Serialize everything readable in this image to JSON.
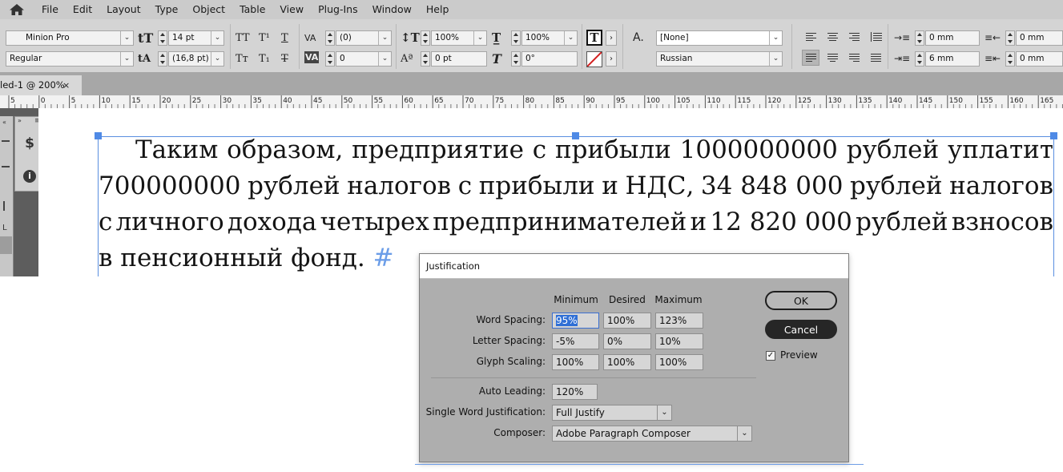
{
  "menu": [
    "File",
    "Edit",
    "Layout",
    "Type",
    "Object",
    "Table",
    "View",
    "Plug-Ins",
    "Window",
    "Help"
  ],
  "control": {
    "font_family": "Minion Pro",
    "font_style": "Regular",
    "font_size": "14 pt",
    "leading": "(16,8 pt)",
    "kerning": "(0)",
    "tracking": "0",
    "vertical_scale": "100%",
    "horizontal_scale": "100%",
    "baseline_shift": "0 pt",
    "skew": "0°",
    "char_style": "[None]",
    "language": "Russian",
    "left_indent": "0 mm",
    "right_indent": "0 mm",
    "first_line_indent": "6 mm",
    "last_line_indent": "0 mm"
  },
  "tab": {
    "label": "led-1 @ 200%",
    "close": "×"
  },
  "ruler": {
    "labels": [
      "5",
      "0",
      "5",
      "10",
      "15",
      "20",
      "25",
      "30",
      "35",
      "40",
      "45",
      "50",
      "55",
      "60",
      "65",
      "70",
      "75",
      "80",
      "85",
      "90",
      "95",
      "100",
      "105",
      "110",
      "115",
      "120",
      "125",
      "130",
      "135",
      "140",
      "145",
      "150",
      "155",
      "160",
      "165"
    ]
  },
  "text": {
    "line1": [
      "Таким",
      "образом,",
      "предприятие",
      "с",
      "прибыли",
      "1000000000",
      "рублей",
      "уплатит"
    ],
    "line2": [
      "700000000",
      "рублей",
      "налогов",
      "с",
      "прибыли",
      "и",
      "НДС,",
      "34 848 000",
      "рублей",
      "налогов"
    ],
    "line3": [
      "с",
      "личного",
      "дохода",
      "четырех",
      "предпринимателей",
      "и",
      "12 820 000",
      "рублей",
      "взносов"
    ],
    "line4": "в пенсионный фонд.",
    "end_mark": "#"
  },
  "dialog": {
    "title": "Justification",
    "headers": {
      "min": "Minimum",
      "desired": "Desired",
      "max": "Maximum"
    },
    "word_spacing": {
      "label": "Word Spacing:",
      "min": "95%",
      "desired": "100%",
      "max": "123%"
    },
    "letter_spacing": {
      "label": "Letter Spacing:",
      "min": "-5%",
      "desired": "0%",
      "max": "10%"
    },
    "glyph_scaling": {
      "label": "Glyph Scaling:",
      "min": "100%",
      "desired": "100%",
      "max": "100%"
    },
    "auto_leading": {
      "label": "Auto Leading:",
      "value": "120%"
    },
    "single_word": {
      "label": "Single Word Justification:",
      "value": "Full Justify"
    },
    "composer": {
      "label": "Composer:",
      "value": "Adobe Paragraph Composer"
    },
    "ok": "OK",
    "cancel": "Cancel",
    "preview": {
      "label": "Preview",
      "checked": true
    }
  },
  "colors": {
    "selection": "#4f8ae6",
    "dialog_bg": "#aeaeae",
    "highlight": "#2f6fd6"
  }
}
